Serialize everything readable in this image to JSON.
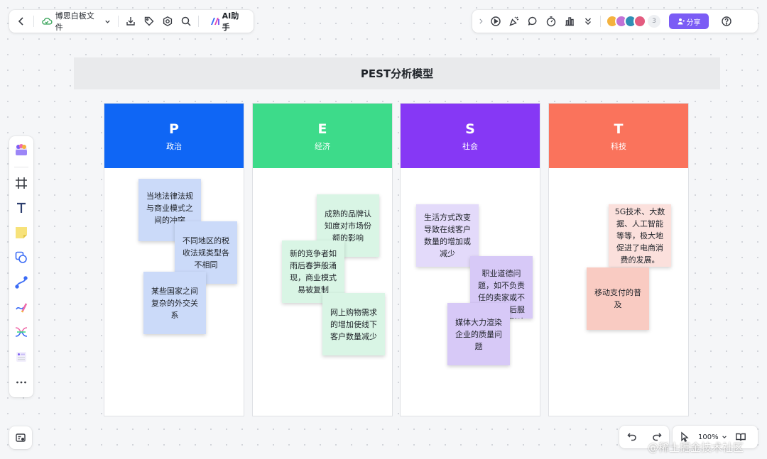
{
  "toolbar": {
    "file_name": "博思白板文件",
    "ai_label": "AI助手",
    "share_label": "分享",
    "avatar_count": "3"
  },
  "board": {
    "title": "PEST分析模型",
    "columns": [
      {
        "letter": "P",
        "label": "政治",
        "color": "#0f66f5"
      },
      {
        "letter": "E",
        "label": "经济",
        "color": "#3ddb8a"
      },
      {
        "letter": "S",
        "label": "社会",
        "color": "#8638f5"
      },
      {
        "letter": "T",
        "label": "科技",
        "color": "#fa735c"
      }
    ],
    "notes": {
      "p1": "当地法律法规与商业模式之间的冲突",
      "p2": "不同地区的税收法规类型各不相同",
      "p3": "某些国家之间复杂的外交关系",
      "e1": "成熟的品牌认知度对市场份额的影响",
      "e2": "新的竞争者如雨后春笋般涌现，商业模式易被复制",
      "e3": "网上购物需求的增加使线下客户数量减少",
      "s1": "生活方式改变导致在线客户数量的增加或减少",
      "s2": "职业道德问题，如不负责任的卖家或不完善的售后服务会不良影响了企业形象",
      "s3": "媒体大力渲染企业的质量问题",
      "t1": "5G技术、大数据、人工智能等等，极大地促进了电商消费的发展。",
      "t2": "移动支付的普及"
    }
  },
  "zoom": {
    "level": "100%"
  },
  "watermark": "@稀土掘金技术社区"
}
